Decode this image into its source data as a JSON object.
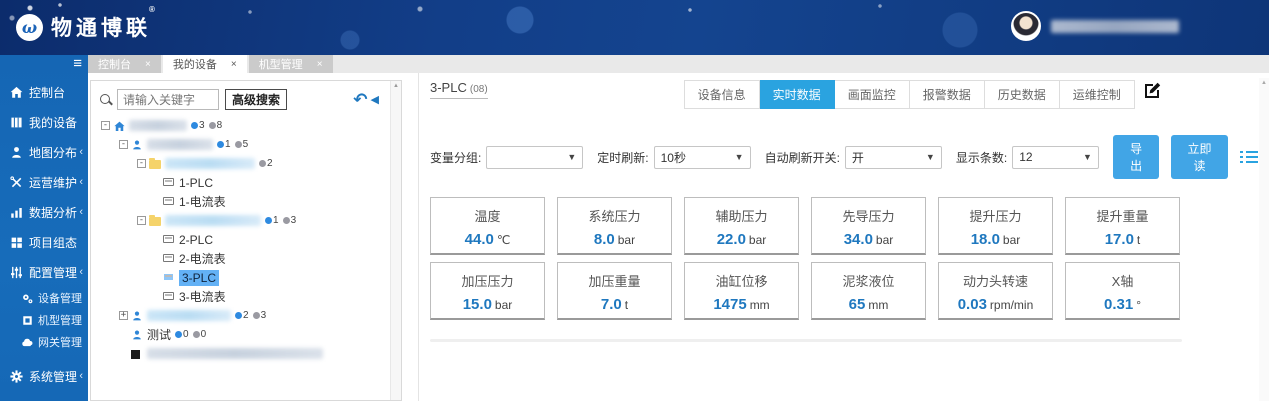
{
  "brand": {
    "logo_glyph": "ω",
    "logo_text": "物通博联",
    "reg_mark": "®"
  },
  "top_tabs": [
    {
      "label": "控制台",
      "close": "×",
      "active": false
    },
    {
      "label": "我的设备",
      "close": "×",
      "active": true
    },
    {
      "label": "机型管理",
      "close": "×",
      "active": false
    }
  ],
  "sidebar": {
    "hamburger": "≡",
    "chevron": "‹",
    "items": [
      {
        "label": "控制台",
        "icon": "home-icon",
        "chevron": ""
      },
      {
        "label": "我的设备",
        "icon": "devices-icon",
        "chevron": ""
      },
      {
        "label": "地图分布",
        "icon": "map-person-icon",
        "chevron": "‹"
      },
      {
        "label": "运营维护",
        "icon": "tools-icon",
        "chevron": "‹"
      },
      {
        "label": "数据分析",
        "icon": "chart-icon",
        "chevron": "‹"
      },
      {
        "label": "项目组态",
        "icon": "grid-icon",
        "chevron": ""
      },
      {
        "label": "配置管理",
        "icon": "sliders-icon",
        "chevron": "‹"
      }
    ],
    "subitems": [
      {
        "label": "设备管理",
        "icon": "gears-icon"
      },
      {
        "label": "机型管理",
        "icon": "box-icon"
      },
      {
        "label": "网关管理",
        "icon": "cloud-icon"
      }
    ],
    "items_after": [
      {
        "label": "系统管理",
        "icon": "gear-icon",
        "chevron": "‹"
      }
    ]
  },
  "tree": {
    "search_placeholder": "请输入关键字",
    "advanced_search_label": "高级搜索",
    "undo_icon": "↶",
    "collapse_icon": "◀",
    "nodes": [
      {
        "icon": "home-icon",
        "blurred": true,
        "label": "",
        "badges": [
          "3",
          "8"
        ],
        "expander": "-"
      },
      {
        "icon": "user-icon",
        "blurred": true,
        "label": "",
        "badges": [
          "1",
          "5"
        ],
        "expander": "-"
      },
      {
        "icon": "folder-icon",
        "blurred": true,
        "label": "",
        "badges": [
          "2"
        ],
        "expander": "-"
      },
      {
        "icon": "device-icon",
        "blurred": false,
        "label": "1-PLC",
        "badges": []
      },
      {
        "icon": "device-icon",
        "blurred": false,
        "label": "1-电流表",
        "badges": []
      },
      {
        "icon": "folder-icon",
        "blurred": true,
        "label": "",
        "badges": [
          "1",
          "3"
        ],
        "expander": "-"
      },
      {
        "icon": "device-icon",
        "blurred": false,
        "label": "2-PLC",
        "badges": []
      },
      {
        "icon": "device-icon",
        "blurred": false,
        "label": "2-电流表",
        "badges": []
      },
      {
        "icon": "device-icon",
        "blurred": false,
        "label": "3-PLC",
        "badges": [],
        "selected": true
      },
      {
        "icon": "device-icon",
        "blurred": false,
        "label": "3-电流表",
        "badges": []
      },
      {
        "icon": "folder-icon",
        "blurred": true,
        "label": "",
        "badges": [
          "2",
          "3"
        ],
        "expander": "+"
      },
      {
        "icon": "user-icon",
        "blurred": false,
        "label": "测试",
        "badges": [
          "0",
          "0"
        ]
      },
      {
        "icon": "dark-square-icon",
        "blurred": true,
        "label": "",
        "badges": []
      }
    ]
  },
  "device_panel": {
    "title": "3-PLC",
    "title_suffix": "(08)",
    "tabs": [
      {
        "label": "设备信息",
        "active": false
      },
      {
        "label": "实时数据",
        "active": true
      },
      {
        "label": "画面监控",
        "active": false
      },
      {
        "label": "报警数据",
        "active": false
      },
      {
        "label": "历史数据",
        "active": false
      },
      {
        "label": "运维控制",
        "active": false
      }
    ]
  },
  "filters": {
    "group_label": "变量分组:",
    "group_value": "",
    "refresh_label": "定时刷新:",
    "refresh_value": "10秒",
    "auto_label": "自动刷新开关:",
    "auto_value": "开",
    "count_label": "显示条数:",
    "count_value": "12",
    "export_label": "导出",
    "read_now_label": "立即读",
    "caret": "▼"
  },
  "cards": [
    {
      "label": "温度",
      "value": "44.0",
      "unit": "℃"
    },
    {
      "label": "系统压力",
      "value": "8.0",
      "unit": "bar"
    },
    {
      "label": "辅助压力",
      "value": "22.0",
      "unit": "bar"
    },
    {
      "label": "先导压力",
      "value": "34.0",
      "unit": "bar"
    },
    {
      "label": "提升压力",
      "value": "18.0",
      "unit": "bar"
    },
    {
      "label": "提升重量",
      "value": "17.0",
      "unit": "t"
    },
    {
      "label": "加压压力",
      "value": "15.0",
      "unit": "bar"
    },
    {
      "label": "加压重量",
      "value": "7.0",
      "unit": "t"
    },
    {
      "label": "油缸位移",
      "value": "1475",
      "unit": "mm"
    },
    {
      "label": "泥浆液位",
      "value": "65",
      "unit": "mm"
    },
    {
      "label": "动力头转速",
      "value": "0.03",
      "unit": "rpm/min"
    },
    {
      "label": "X轴",
      "value": "0.31",
      "unit": "°"
    }
  ],
  "colors": {
    "header_navy": "#123e88",
    "sidebar_blue": "#1667b5",
    "accent_blue": "#2aa3e0",
    "value_blue": "#1f78bf",
    "selected_node_blue": "#63b1f5",
    "folder_yellow": "#f5d36a"
  }
}
